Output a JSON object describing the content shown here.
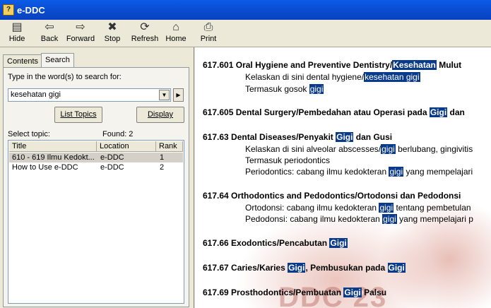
{
  "window": {
    "title": "e-DDC"
  },
  "toolbar": {
    "buttons": [
      {
        "label": "Hide",
        "icon": "hide-icon"
      },
      {
        "label": "Back",
        "icon": "back-arrow-icon"
      },
      {
        "label": "Forward",
        "icon": "forward-arrow-icon"
      },
      {
        "label": "Stop",
        "icon": "stop-icon"
      },
      {
        "label": "Refresh",
        "icon": "refresh-icon"
      },
      {
        "label": "Home",
        "icon": "home-icon"
      },
      {
        "label": "Print",
        "icon": "printer-icon"
      }
    ]
  },
  "nav": {
    "tabs": [
      {
        "label": "Contents"
      },
      {
        "label": "Search"
      }
    ],
    "active_tab": "Search",
    "search": {
      "prompt": "Type in the word(s) to search for:",
      "value": "kesehatan gigi",
      "list_topics": "List Topics",
      "display": "Display",
      "select_topic": "Select topic:",
      "found": "Found: 2"
    },
    "columns": [
      "Title",
      "Location",
      "Rank"
    ],
    "rows": [
      {
        "title": "610 - 619 Ilmu Kedokt...",
        "location": "e-DDC",
        "rank": "1"
      },
      {
        "title": "How to Use e-DDC",
        "location": "e-DDC",
        "rank": "2"
      }
    ]
  },
  "content": {
    "cover_text": "DDC 23",
    "highlight_color": "#0a3a8a",
    "entries": [
      {
        "code": "617.601",
        "heading": "Oral Hygiene and Preventive Dentistry/",
        "highlight": "Kesehatan",
        "tail": " Mulut",
        "lines": [
          {
            "pre": "Kelaskan di sini dental hygiene/",
            "hl": "kesehatan gigi",
            "post": ""
          },
          {
            "pre": "Termasuk gosok ",
            "hl": "gigi",
            "post": ""
          }
        ]
      },
      {
        "code": "617.605",
        "heading": "Dental Surgery/Pembedahan atau Operasi pada ",
        "highlight": "Gigi",
        "tail": " dan"
      },
      {
        "code": "617.63",
        "heading": "Dental Diseases/Penyakit ",
        "highlight": "Gigi",
        "tail": " dan Gusi",
        "lines": [
          {
            "pre": "Kelaskan di sini alveolar abscesses/",
            "hl": "gigi",
            "post": " berlubang, gingivitis"
          },
          {
            "pre": "Termasuk periodontics",
            "hl": "",
            "post": ""
          },
          {
            "pre": "Periodontics: cabang ilmu kedokteran ",
            "hl": "gigi",
            "post": " yang mempelajari"
          }
        ]
      },
      {
        "code": "617.64",
        "heading": "Orthodontics and Pedodontics/Ortodonsi dan Pedodonsi",
        "highlight": "",
        "tail": "",
        "lines": [
          {
            "pre": "Ortodonsi: cabang ilmu kedokteran ",
            "hl": "gigi",
            "post": " tentang pembetulan"
          },
          {
            "pre": "Pedodonsi: cabang ilmu kedokteran ",
            "hl": "gigi",
            "post": " yang mempelajari p"
          }
        ]
      },
      {
        "code": "617.66",
        "heading": "Exodontics/Pencabutan ",
        "highlight": "Gigi",
        "tail": ""
      },
      {
        "code": "617.67",
        "heading": "Caries/Karies ",
        "highlight": "Gigi",
        "tail": ", Pembusukan pada ",
        "highlight2": "Gigi"
      },
      {
        "code": "617.69",
        "heading": "Prosthodontics/Pembuatan ",
        "highlight": "Gigi",
        "tail": " Palsu"
      }
    ]
  }
}
